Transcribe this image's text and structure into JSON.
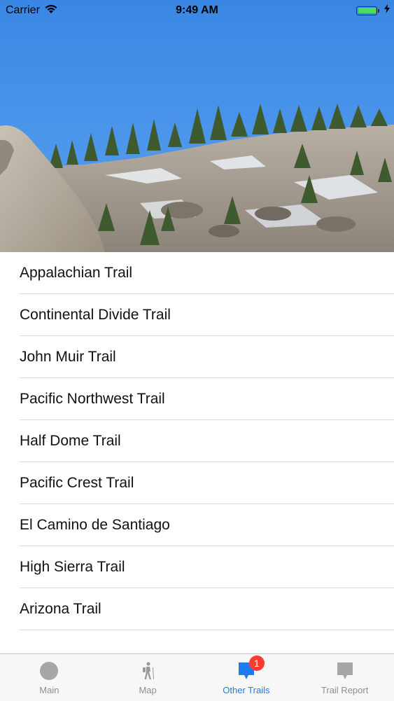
{
  "status_bar": {
    "carrier": "Carrier",
    "time": "9:49 AM"
  },
  "hero": {
    "image": "mountain-granite-forest-photo"
  },
  "trails": [
    {
      "label": "Appalachian Trail"
    },
    {
      "label": "Continental Divide Trail"
    },
    {
      "label": "John Muir Trail"
    },
    {
      "label": "Pacific Northwest Trail"
    },
    {
      "label": "Half Dome Trail"
    },
    {
      "label": "Pacific Crest Trail"
    },
    {
      "label": "El Camino de Santiago"
    },
    {
      "label": "High Sierra Trail"
    },
    {
      "label": "Arizona Trail"
    }
  ],
  "tabbar": {
    "tabs": [
      {
        "label": "Main",
        "icon": "circle-icon"
      },
      {
        "label": "Map",
        "icon": "hiker-icon"
      },
      {
        "label": "Other Trails",
        "icon": "chat-bubble-icon",
        "badge": "1",
        "active": true
      },
      {
        "label": "Trail Report",
        "icon": "report-bubble-icon"
      }
    ]
  },
  "colors": {
    "accent": "#1a7cf0",
    "inactive": "#8e8e93",
    "badge": "#ff3b30",
    "battery": "#4cd964",
    "sky": "#3f8fe8"
  }
}
